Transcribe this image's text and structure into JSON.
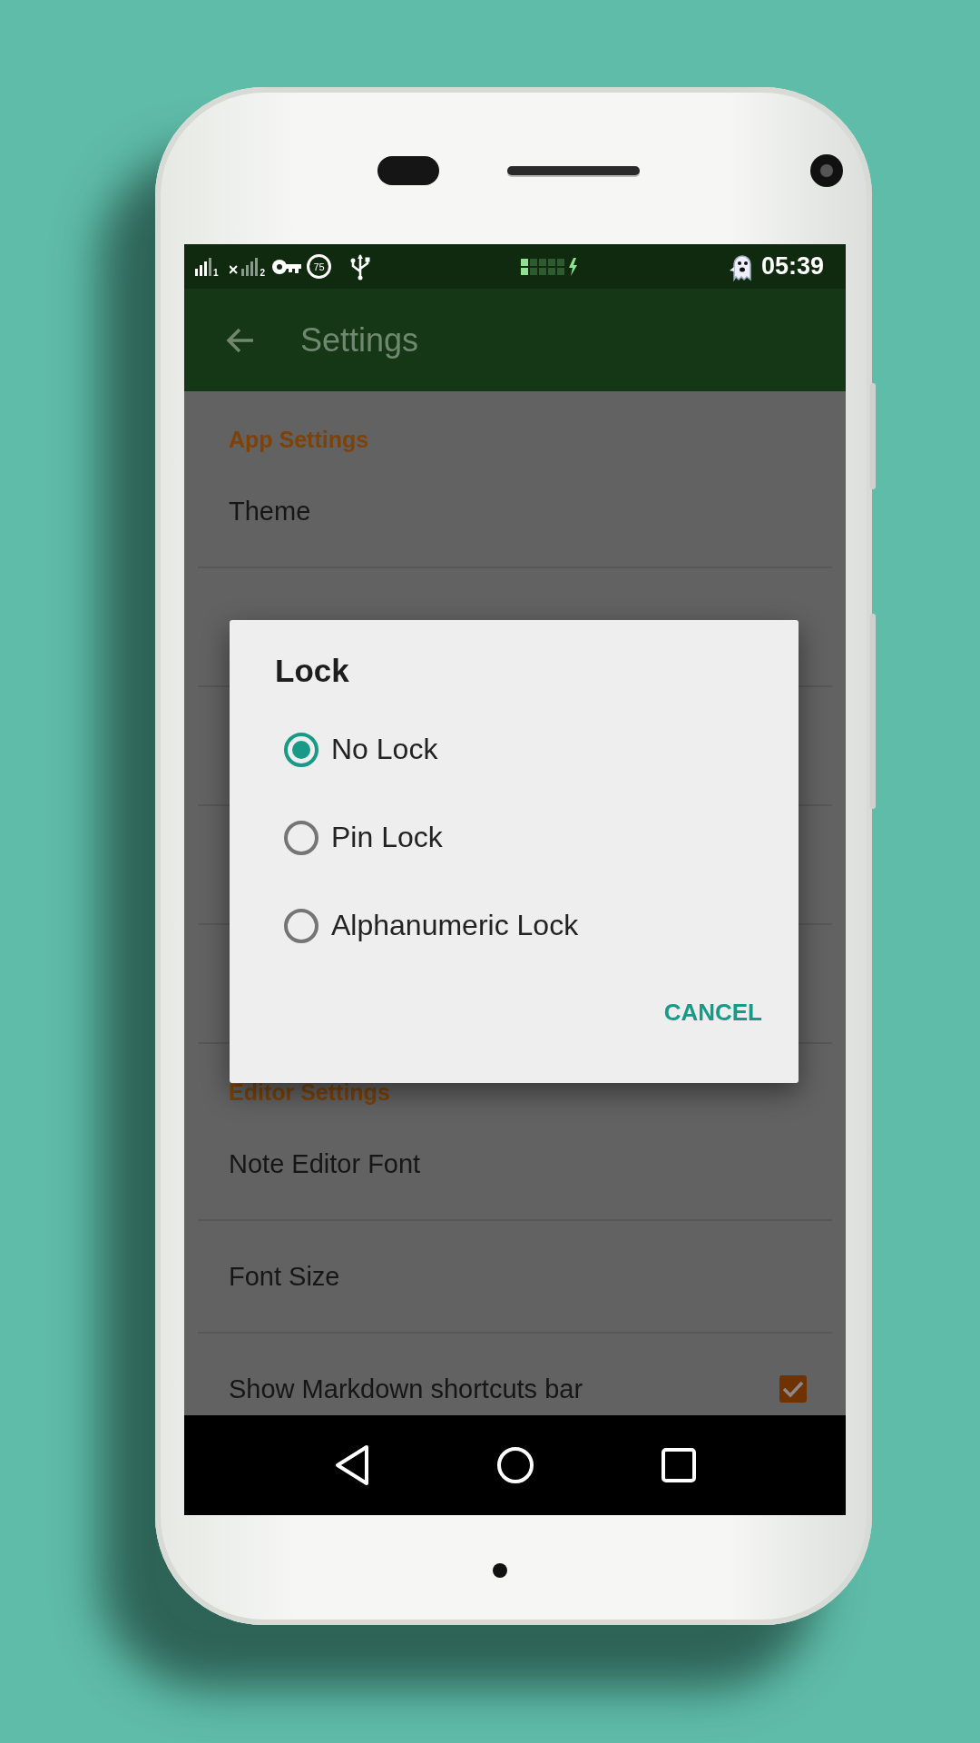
{
  "status_bar": {
    "sim1_slot": "1",
    "sim2_slot": "2",
    "percent": "75",
    "time": "05:39"
  },
  "app_bar": {
    "title": "Settings"
  },
  "settings": {
    "sections": [
      {
        "header": "App Settings",
        "items": [
          {
            "kind": "text",
            "label": "Theme"
          }
        ]
      },
      {
        "header": "Editor Settings",
        "items": [
          {
            "kind": "text",
            "label": "Note Editor Font"
          },
          {
            "kind": "text",
            "label": "Font Size"
          },
          {
            "kind": "checkbox",
            "label": "Show Markdown shortcuts bar",
            "checked": true
          }
        ]
      }
    ]
  },
  "dialog": {
    "title": "Lock",
    "options": [
      {
        "label": "No Lock",
        "selected": true
      },
      {
        "label": "Pin Lock",
        "selected": false
      },
      {
        "label": "Alphanumeric Lock",
        "selected": false
      }
    ],
    "buttons": [
      "CANCEL"
    ]
  }
}
